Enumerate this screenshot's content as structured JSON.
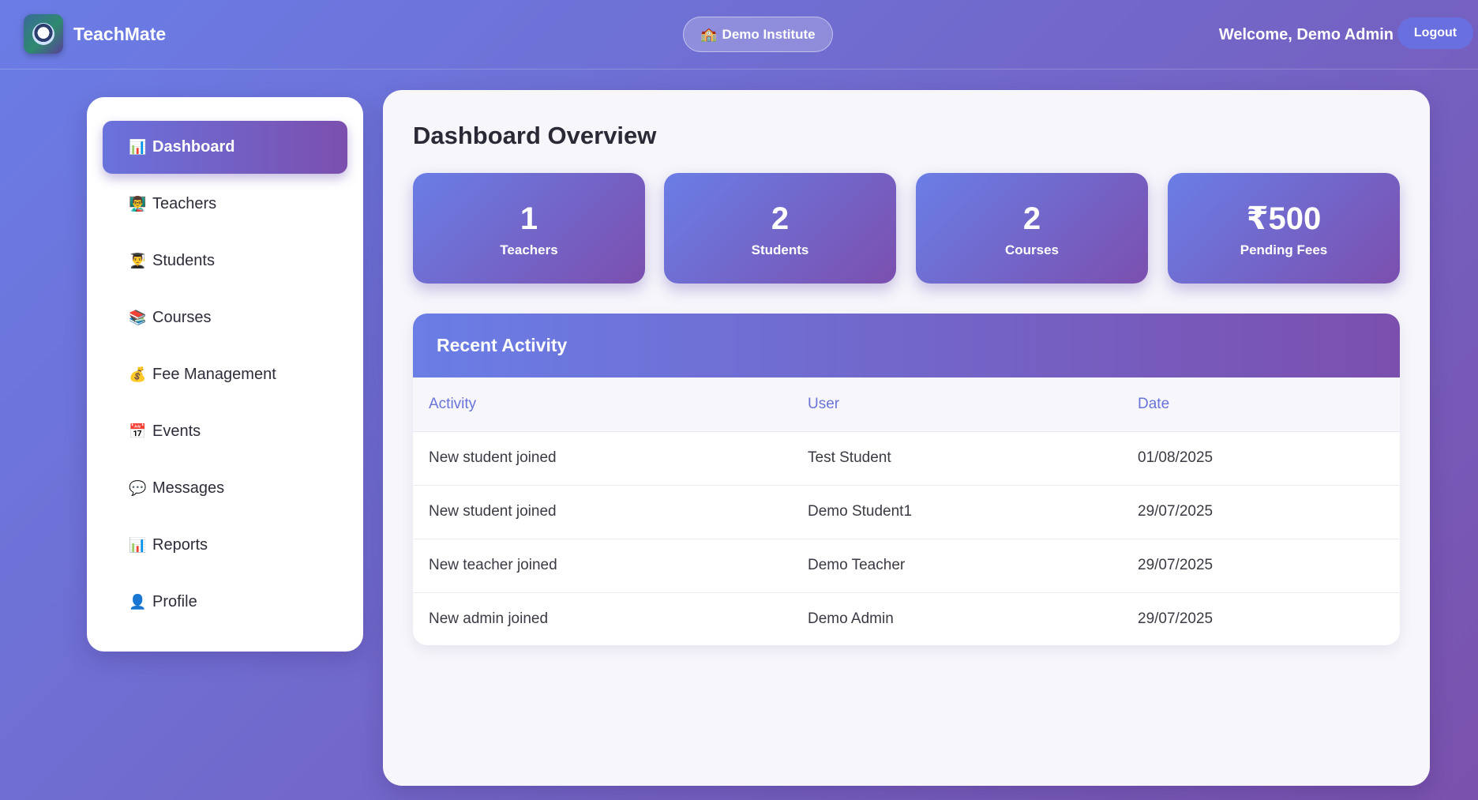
{
  "header": {
    "app_name": "TeachMate",
    "institute": "Demo Institute",
    "institute_icon": "🏫",
    "welcome": "Welcome, Demo Admin",
    "logout_label": "Logout"
  },
  "sidebar": {
    "items": [
      {
        "label": "Dashboard",
        "icon": "📊",
        "active": true
      },
      {
        "label": "Teachers",
        "icon": "👨‍🏫"
      },
      {
        "label": "Students",
        "icon": "👨‍🎓"
      },
      {
        "label": "Courses",
        "icon": "📚"
      },
      {
        "label": "Fee Management",
        "icon": "💰"
      },
      {
        "label": "Events",
        "icon": "📅"
      },
      {
        "label": "Messages",
        "icon": "💬"
      },
      {
        "label": "Reports",
        "icon": "📊"
      },
      {
        "label": "Profile",
        "icon": "👤"
      }
    ]
  },
  "main": {
    "title": "Dashboard Overview",
    "stats": [
      {
        "value": "1",
        "label": "Teachers"
      },
      {
        "value": "2",
        "label": "Students"
      },
      {
        "value": "2",
        "label": "Courses"
      },
      {
        "value": "₹500",
        "label": "Pending Fees"
      }
    ],
    "activity": {
      "title": "Recent Activity",
      "columns": [
        "Activity",
        "User",
        "Date"
      ],
      "rows": [
        [
          "New student joined",
          "Test Student",
          "01/08/2025"
        ],
        [
          "New student joined",
          "Demo Student1",
          "29/07/2025"
        ],
        [
          "New teacher joined",
          "Demo Teacher",
          "29/07/2025"
        ],
        [
          "New admin joined",
          "Demo Admin",
          "29/07/2025"
        ]
      ]
    }
  },
  "colors": {
    "gradient_start": "#6a7de6",
    "gradient_end": "#7a52ad",
    "table_header_text": "#6a74d8"
  }
}
